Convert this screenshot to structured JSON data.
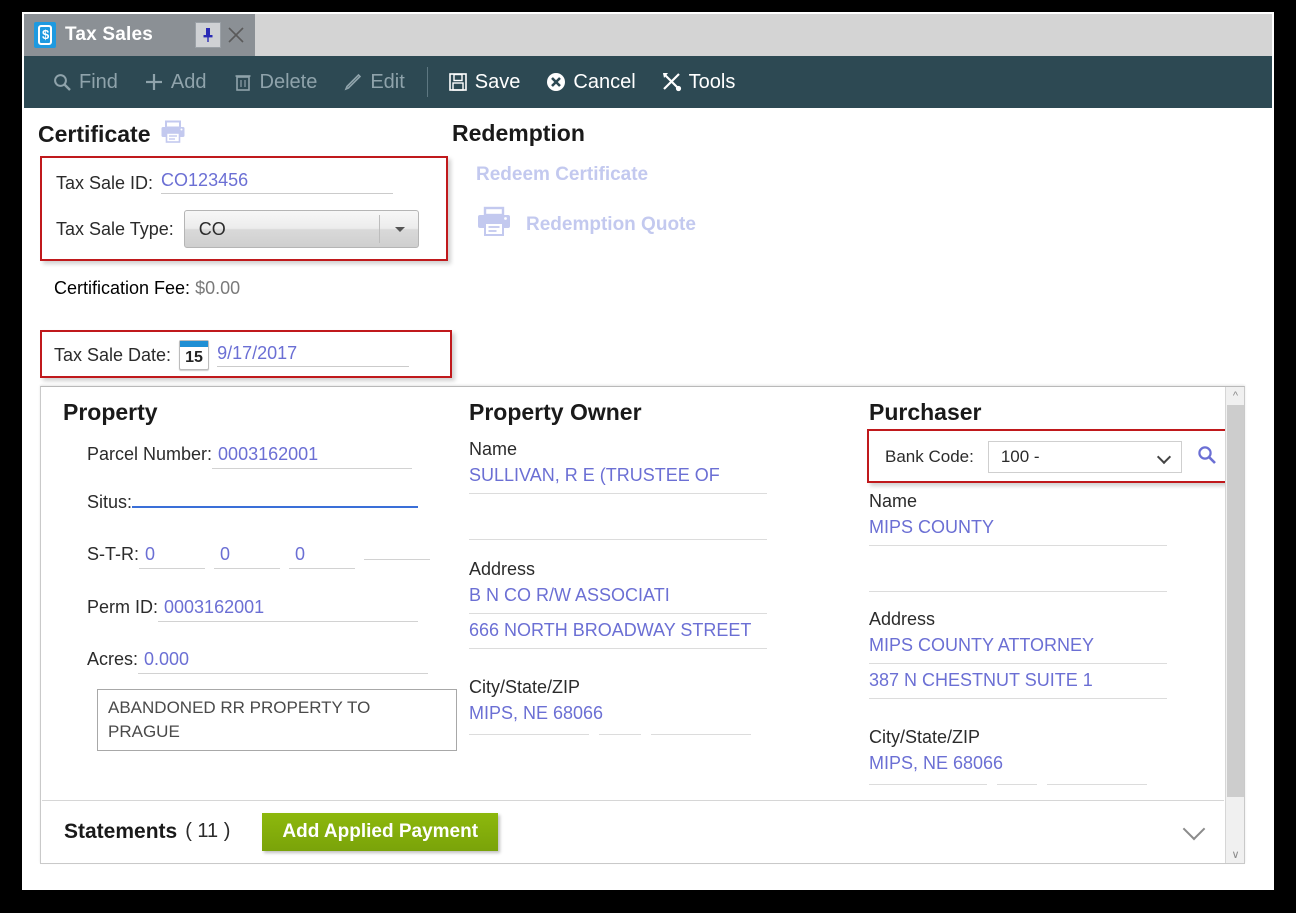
{
  "window": {
    "tab_title": "Tax Sales",
    "tab_icon": "tax-tag-icon",
    "pin_icon": "pin-icon",
    "close_icon": "close-icon"
  },
  "toolbar": {
    "items": [
      {
        "label": "Find",
        "icon": "search-icon",
        "enabled": false
      },
      {
        "label": "Add",
        "icon": "plus-icon",
        "enabled": false
      },
      {
        "label": "Delete",
        "icon": "trash-icon",
        "enabled": false
      },
      {
        "label": "Edit",
        "icon": "pencil-icon",
        "enabled": false
      },
      {
        "label": "Save",
        "icon": "save-icon",
        "enabled": true
      },
      {
        "label": "Cancel",
        "icon": "cancel-icon",
        "enabled": true
      },
      {
        "label": "Tools",
        "icon": "tools-icon",
        "enabled": true
      }
    ]
  },
  "certificate": {
    "heading": "Certificate",
    "print_icon": "printer-icon",
    "tax_sale_id_label": "Tax Sale ID:",
    "tax_sale_id_value": "CO123456",
    "tax_sale_type_label": "Tax Sale Type:",
    "tax_sale_type_value": "CO",
    "certification_fee_label": "Certification Fee:",
    "certification_fee_value": "$0.00",
    "tax_sale_date_label": "Tax Sale Date:",
    "tax_sale_date_value": "9/17/2017",
    "calendar_day": "15"
  },
  "redemption": {
    "heading": "Redemption",
    "redeem_certificate_label": "Redeem Certificate",
    "redemption_quote_label": "Redemption Quote",
    "quote_icon": "printer-icon"
  },
  "property": {
    "heading": "Property",
    "parcel_number_label": "Parcel Number:",
    "parcel_number_value": "0003162001",
    "situs_label": "Situs:",
    "situs_value": "",
    "str_label": "S-T-R:",
    "str_values": [
      "0",
      "0",
      "0",
      ""
    ],
    "perm_id_label": "Perm ID:",
    "perm_id_value": "0003162001",
    "acres_label": "Acres:",
    "acres_value": "0.000",
    "description": "ABANDONED RR PROPERTY TO PRAGUE"
  },
  "property_owner": {
    "heading": "Property Owner",
    "name_caption": "Name",
    "name_line1": "SULLIVAN, R E (TRUSTEE OF",
    "name_line2": "",
    "address_caption": "Address",
    "address_line1": "B N CO R/W ASSOCIATI",
    "address_line2": "666 NORTH BROADWAY STREET",
    "citystatezip_caption": "City/State/ZIP",
    "citystatezip_value": "MIPS, NE  68066"
  },
  "purchaser": {
    "heading": "Purchaser",
    "bank_code_label": "Bank Code:",
    "bank_code_value": "100 -",
    "search_icon": "search-icon",
    "name_caption": "Name",
    "name_line1": "MIPS COUNTY",
    "name_line2": "",
    "address_caption": "Address",
    "address_line1": "MIPS COUNTY ATTORNEY",
    "address_line2": "387 N CHESTNUT SUITE 1",
    "citystatezip_caption": "City/State/ZIP",
    "citystatezip_value": "MIPS, NE 68066"
  },
  "statements": {
    "label": "Statements",
    "count": "( 11 )",
    "add_payment_label": "Add Applied Payment",
    "expand_icon": "chevron-down-icon"
  },
  "colors": {
    "toolbar_bg": "#2d4953",
    "tab_bg": "#8b9095",
    "tab_icon": "#1e9ae0",
    "value_text": "#6b6fd4",
    "highlight_box": "#c0191c",
    "primary_button": "#8db80c",
    "disabled_link": "#c3c9ef",
    "focus_underline": "#3a6fd8"
  }
}
